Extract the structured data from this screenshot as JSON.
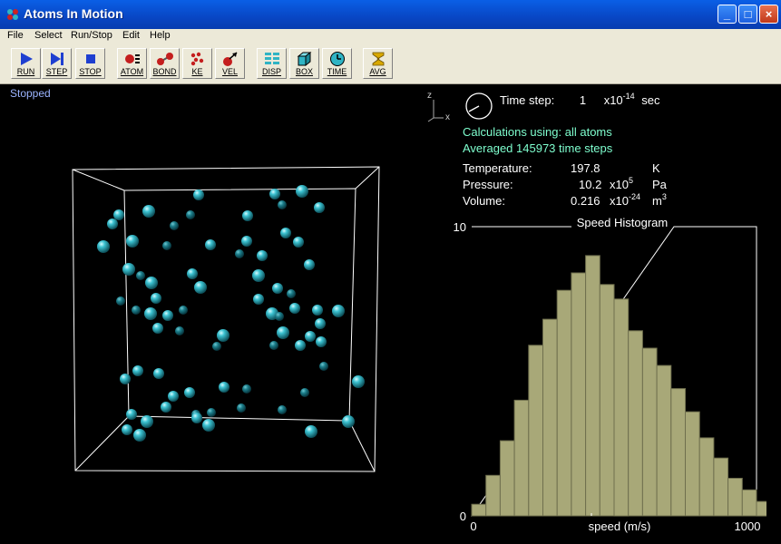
{
  "window": {
    "title": "Atoms In Motion"
  },
  "window_buttons": {
    "minimize": "_",
    "maximize": "□",
    "close": "×"
  },
  "menu": [
    "File",
    "Select",
    "Run/Stop",
    "Edit",
    "Help"
  ],
  "toolbar": [
    {
      "label": "RUN",
      "icon": "play-icon"
    },
    {
      "label": "STEP",
      "icon": "step-icon"
    },
    {
      "label": "STOP",
      "icon": "stop-icon"
    },
    {
      "label": "ATOM",
      "icon": "atom-icon"
    },
    {
      "label": "BOND",
      "icon": "bond-icon"
    },
    {
      "label": "KE",
      "icon": "kinetic-energy-icon"
    },
    {
      "label": "VEL",
      "icon": "velocity-icon"
    },
    {
      "label": "DISP",
      "icon": "display-icon"
    },
    {
      "label": "BOX",
      "icon": "box-icon"
    },
    {
      "label": "TIME",
      "icon": "clock-icon"
    },
    {
      "label": "AVG",
      "icon": "sigma-icon"
    }
  ],
  "status": "Stopped",
  "axes": {
    "z": "z",
    "x": "x"
  },
  "timestep": {
    "label": "Time step:",
    "value": "1",
    "unit_prefix": "x10",
    "exp": "-14",
    "unit": "sec"
  },
  "calc_line": "Calculations using: all atoms",
  "avg_line": "Averaged 145973 time steps",
  "stats": {
    "temperature": {
      "label": "Temperature:",
      "value": "197.8",
      "unit": "K"
    },
    "pressure": {
      "label": "Pressure:",
      "value": "10.2",
      "mult": "x10",
      "exp": "5",
      "unit": "Pa"
    },
    "volume": {
      "label": "Volume:",
      "value": "0.216",
      "mult": "x10",
      "exp": "-24",
      "unit": "m",
      "unit_exp": "3"
    }
  },
  "colors": {
    "atom": "#2fb4c4",
    "histogram": "#a8a878",
    "box": "#ffffff"
  },
  "chart_data": {
    "type": "bar",
    "title": "Speed Histogram",
    "xlabel": "speed (m/s)",
    "ylabel": "",
    "xlim": [
      0,
      1000
    ],
    "ylim": [
      0,
      10
    ],
    "y_ticks": [
      "0",
      "10"
    ],
    "x_ticks": [
      "0",
      "1000"
    ],
    "bin_width": 50,
    "values": [
      0.4,
      1.4,
      2.6,
      4.0,
      5.9,
      6.8,
      7.8,
      8.4,
      9.0,
      8.0,
      7.5,
      6.4,
      5.8,
      5.2,
      4.4,
      3.6,
      2.7,
      2.0,
      1.3,
      0.9,
      0.5,
      0.2,
      0.1
    ]
  }
}
